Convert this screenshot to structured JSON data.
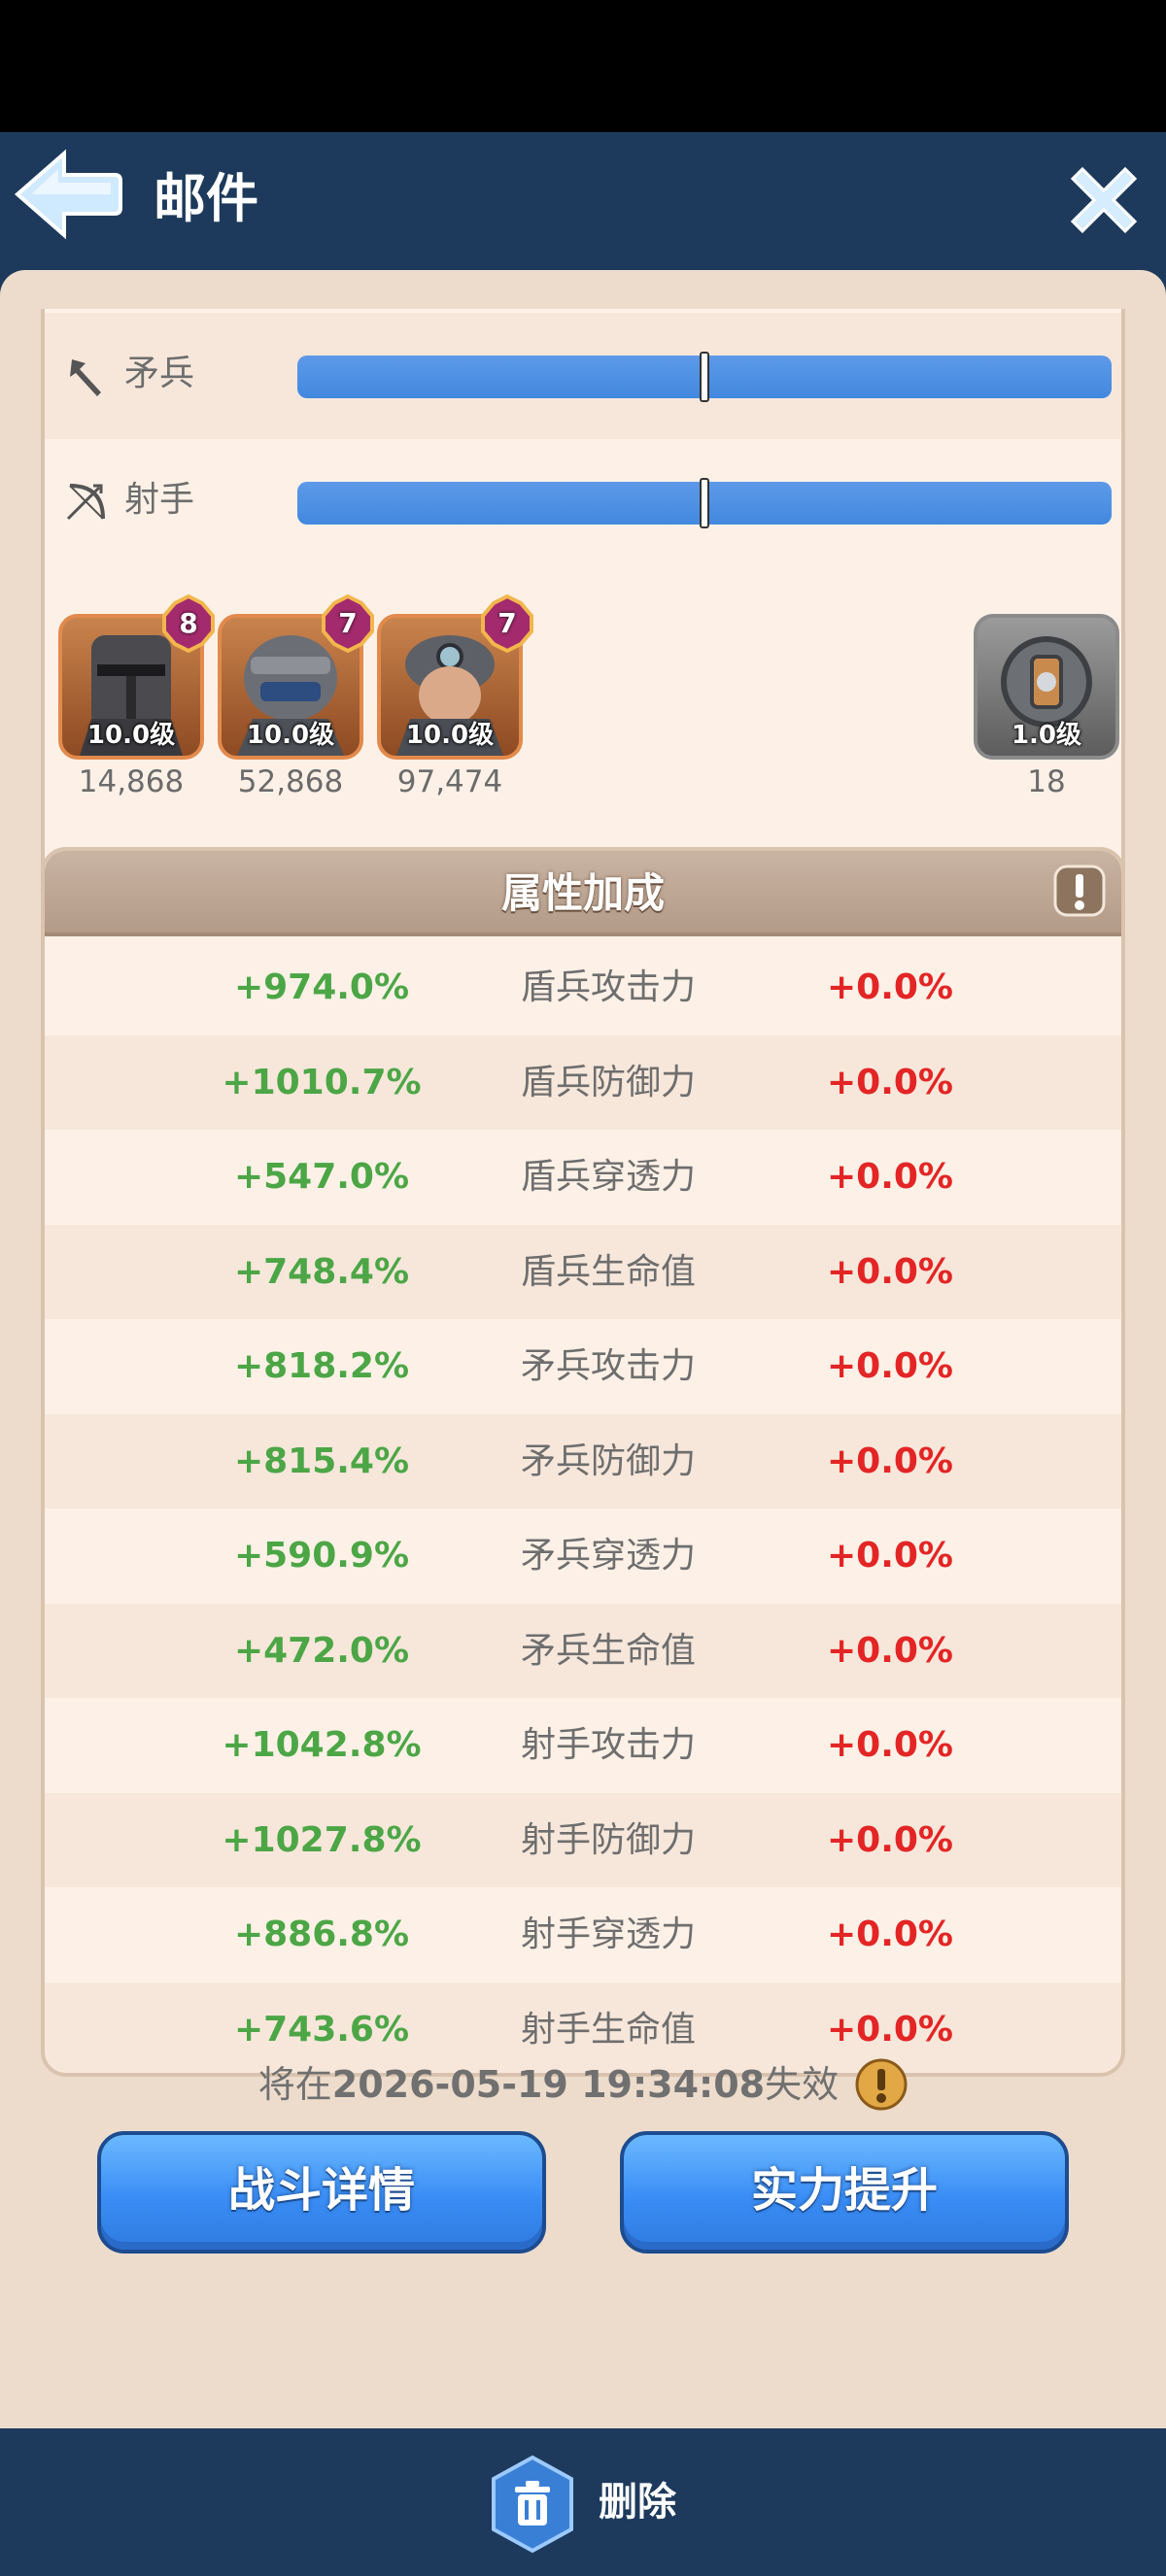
{
  "header": {
    "title": "邮件"
  },
  "troops": [
    {
      "label": "矛兵",
      "ratio": 0.5
    },
    {
      "label": "射手",
      "ratio": 0.5
    }
  ],
  "heroes": [
    {
      "level": "10.0级",
      "stars": "8",
      "power": "14,868"
    },
    {
      "level": "10.0级",
      "stars": "7",
      "power": "52,868"
    },
    {
      "level": "10.0级",
      "stars": "7",
      "power": "97,474"
    }
  ],
  "gear": {
    "level": "1.0级",
    "count": "18"
  },
  "attributes": {
    "title": "属性加成",
    "rows": [
      {
        "value": "+974.0%",
        "name": "盾兵攻击力",
        "delta": "+0.0%"
      },
      {
        "value": "+1010.7%",
        "name": "盾兵防御力",
        "delta": "+0.0%"
      },
      {
        "value": "+547.0%",
        "name": "盾兵穿透力",
        "delta": "+0.0%"
      },
      {
        "value": "+748.4%",
        "name": "盾兵生命值",
        "delta": "+0.0%"
      },
      {
        "value": "+818.2%",
        "name": "矛兵攻击力",
        "delta": "+0.0%"
      },
      {
        "value": "+815.4%",
        "name": "矛兵防御力",
        "delta": "+0.0%"
      },
      {
        "value": "+590.9%",
        "name": "矛兵穿透力",
        "delta": "+0.0%"
      },
      {
        "value": "+472.0%",
        "name": "矛兵生命值",
        "delta": "+0.0%"
      },
      {
        "value": "+1042.8%",
        "name": "射手攻击力",
        "delta": "+0.0%"
      },
      {
        "value": "+1027.8%",
        "name": "射手防御力",
        "delta": "+0.0%"
      },
      {
        "value": "+886.8%",
        "name": "射手穿透力",
        "delta": "+0.0%"
      },
      {
        "value": "+743.6%",
        "name": "射手生命值",
        "delta": "+0.0%"
      }
    ]
  },
  "buttons": {
    "battle_details": "战斗详情",
    "power_up": "实力提升"
  },
  "expiry": {
    "prefix": "将在",
    "datetime": "2026-05-19 19:34:08",
    "suffix": "失效"
  },
  "footer": {
    "delete_label": "删除"
  },
  "colors": {
    "header_bg": "#1d3a5c",
    "panel_bg": "#eddccc",
    "bonus_green": "#4ca646",
    "delta_red": "#e32525",
    "button_blue": "#3a8df5"
  }
}
